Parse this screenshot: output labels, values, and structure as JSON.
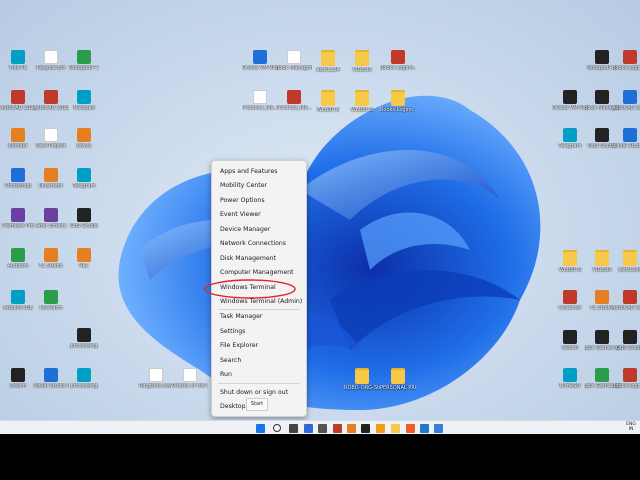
{
  "start_menu": {
    "items": [
      "Apps and Features",
      "Mobility Center",
      "Power Options",
      "Event Viewer",
      "Device Manager",
      "Network Connections",
      "Disk Management",
      "Computer Management",
      "Windows Terminal",
      "Windows Terminal (Admin)",
      "Task Manager",
      "Settings",
      "File Explorer",
      "Search",
      "Run",
      "Shut down or sign out",
      "Desktop"
    ],
    "highlighted": "Task Manager",
    "highlight_color": "#e0242f"
  },
  "tooltip": "Start",
  "desktop": {
    "icons": [
      {
        "label": "This PC"
      },
      {
        "label": "Recycle Bin"
      },
      {
        "label": "Notepad++"
      },
      {
        "label": "Oracle VM VirtualBox"
      },
      {
        "label": "Book Management..."
      },
      {
        "label": "asdf1234"
      },
      {
        "label": "VIDEOS"
      },
      {
        "label": "Books Loginn..."
      },
      {
        "label": "AutoCAD 2022"
      },
      {
        "label": "AutoCAD 2023"
      },
      {
        "label": "Notepad"
      },
      {
        "label": "Practical_file..."
      },
      {
        "label": "WEBSITE"
      },
      {
        "label": "Blender"
      },
      {
        "label": "New Project"
      },
      {
        "label": "Brave"
      },
      {
        "label": "Photoshop"
      },
      {
        "label": "Illustrator"
      },
      {
        "label": "Telegram"
      },
      {
        "label": "Premiere Pro"
      },
      {
        "label": "After Effects"
      },
      {
        "label": "OBS Studio"
      },
      {
        "label": "Audition"
      },
      {
        "label": "FL Studio"
      },
      {
        "label": "VLC"
      },
      {
        "label": "Arduino IDE"
      },
      {
        "label": "PyCharm"
      },
      {
        "label": "Steam"
      },
      {
        "label": "CCleaner"
      },
      {
        "label": "Visual Studio Code"
      },
      {
        "label": "processing"
      },
      {
        "label": "Ringtone.wav"
      },
      {
        "label": "Pirates of the Caribbean -..."
      },
      {
        "label": "ROBO-ORG-Stuff"
      },
      {
        "label": "PERSONAL PROJECT..."
      },
      {
        "label": "UltraISO"
      },
      {
        "label": "Epic Games Launcher"
      }
    ]
  },
  "tray": {
    "lang": "ENG",
    "region": "IN"
  },
  "colors": {
    "taskbar": "#eef1f5",
    "menu_bg": "#f3f3f3",
    "bloom": "#1e5fd6"
  }
}
